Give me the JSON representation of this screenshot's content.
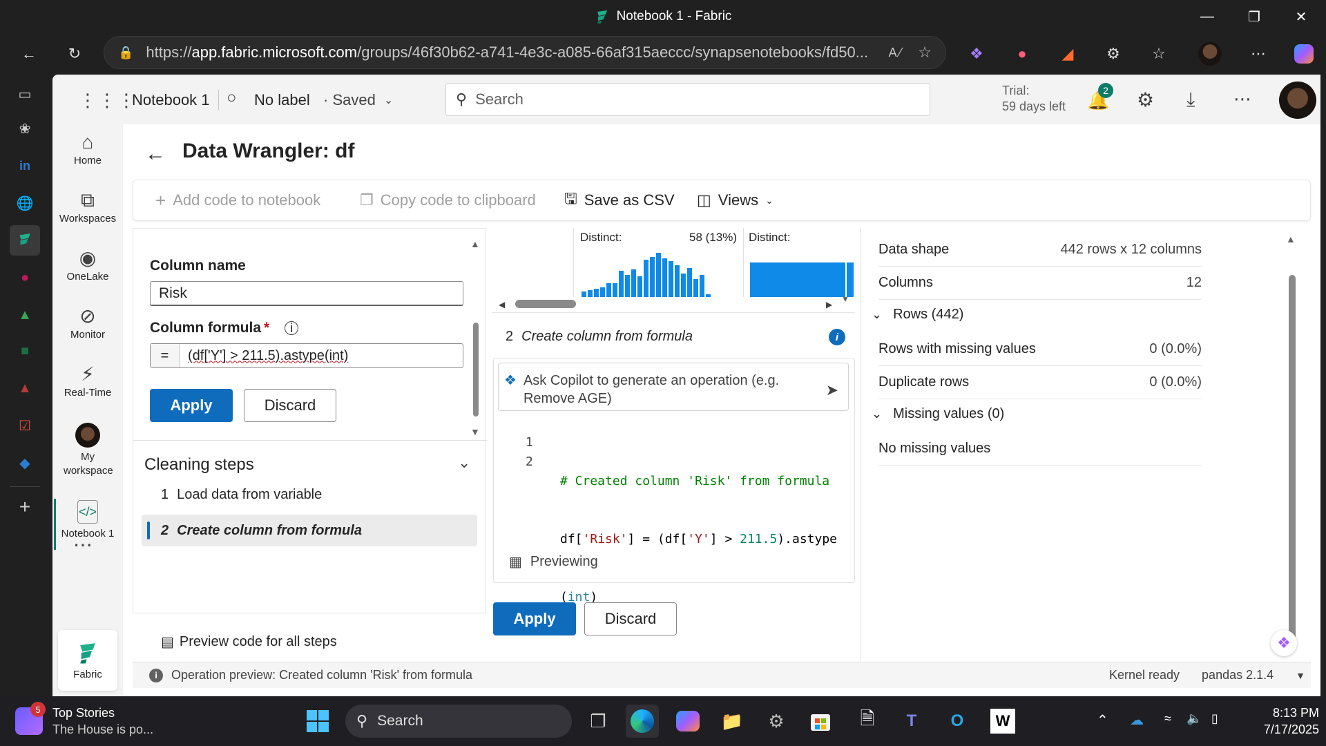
{
  "window": {
    "title": "Notebook 1 - Fabric"
  },
  "browser": {
    "url_prefix": "https://",
    "url_host": "app.fabric.microsoft.com",
    "url_path": "/groups/46f30b62-a741-4e3c-a085-66af315aeccc/synapsenotebooks/fd50..."
  },
  "fabric_header": {
    "notebook_name": "Notebook 1",
    "label": "No label",
    "saved": "· Saved",
    "search_placeholder": "Search",
    "trial_line1": "Trial:",
    "trial_line2": "59 days left",
    "notification_count": "2"
  },
  "left_nav": [
    {
      "label": "Home",
      "icon": "home-icon"
    },
    {
      "label": "Workspaces",
      "icon": "workspaces-icon"
    },
    {
      "label": "OneLake",
      "icon": "onelake-icon"
    },
    {
      "label": "Monitor",
      "icon": "monitor-icon"
    },
    {
      "label": "Real-Time",
      "icon": "lightning-icon"
    },
    {
      "label": "My workspace",
      "icon": "avatar"
    },
    {
      "label": "Notebook 1",
      "icon": "notebook-icon"
    }
  ],
  "fabric_footer": {
    "label": "Fabric"
  },
  "wrangler": {
    "title": "Data Wrangler: df",
    "toolbar": {
      "add_code": "Add code to notebook",
      "copy_code": "Copy code to clipboard",
      "save_csv": "Save as CSV",
      "views": "Views"
    },
    "operation_panel": {
      "column_name_label": "Column name",
      "column_name_value": "Risk",
      "formula_label": "Column formula",
      "formula_required": "*",
      "formula_prefix": "=",
      "formula_value": "(df['Y'] > 211.5).astype(int)",
      "apply": "Apply",
      "discard": "Discard"
    },
    "cleaning_steps": {
      "title": "Cleaning steps",
      "steps": [
        {
          "num": "1",
          "label": "Load data from variable"
        },
        {
          "num": "2",
          "label": "Create column from formula"
        }
      ],
      "preview_all": "Preview code for all steps"
    },
    "grid": {
      "col1_distinct_label": "Distinct:",
      "col1_distinct_value": "58 (13%)",
      "col2_distinct_label": "Distinct:"
    },
    "code_panel": {
      "step_num": "2",
      "step_title": "Create column from formula",
      "copilot_placeholder": "Ask Copilot to generate an operation (e.g. Remove AGE)",
      "line1_num": "1",
      "line1_code": "# Created column 'Risk' from formula",
      "line2_num": "2",
      "line2_a": "df[",
      "line2_b": "'Risk'",
      "line2_c": "] = (df[",
      "line2_d": "'Y'",
      "line2_e": "] > ",
      "line2_f": "211.5",
      "line2_g": ").astype",
      "line3_a": "(",
      "line3_b": "int",
      "line3_c": ")",
      "previewing": "Previewing",
      "apply": "Apply",
      "discard": "Discard"
    },
    "summary": {
      "data_shape_label": "Data shape",
      "data_shape_value": "442 rows x 12 columns",
      "columns_label": "Columns",
      "columns_value": "12",
      "rows_header": "Rows (442)",
      "missing_rows_label": "Rows with missing values",
      "missing_rows_value": "0 (0.0%)",
      "dup_rows_label": "Duplicate rows",
      "dup_rows_value": "0 (0.0%)",
      "missing_header": "Missing values (0)",
      "no_missing": "No missing values"
    },
    "status": {
      "message": "Operation preview: Created column 'Risk' from formula",
      "kernel": "Kernel ready",
      "pandas": "pandas 2.1.4"
    }
  },
  "taskbar": {
    "news_badge": "5",
    "news_title": "Top Stories",
    "news_sub": "The House is po...",
    "search": "Search",
    "time": "8:13 PM",
    "date": "7/17/2025"
  },
  "colors": {
    "accent": "#0f6cbd",
    "histogram": "#0f8ae8",
    "green": "#107c41"
  }
}
